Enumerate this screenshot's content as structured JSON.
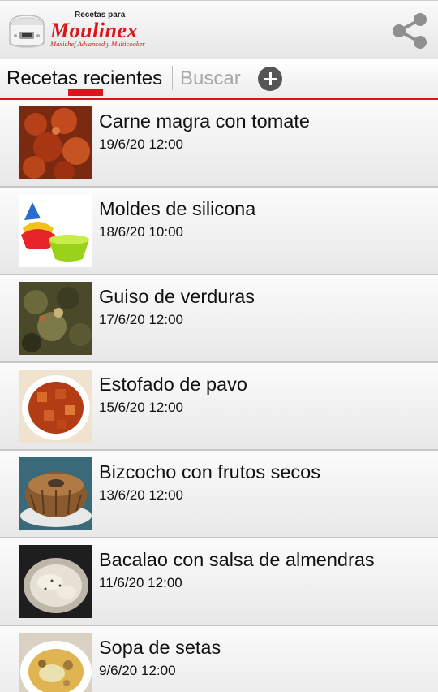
{
  "header": {
    "logo_top": "Recetas para",
    "logo_brand": "Moulinex",
    "logo_sub": "Maxichef Advanced y Multicooker",
    "share_icon": "share-icon",
    "app_icon": "multicooker-icon"
  },
  "tabs": {
    "recent_label": "Recetas recientes",
    "search_label": "Buscar",
    "add_icon": "plus-circle-icon"
  },
  "colors": {
    "accent": "#d9161c",
    "tab_inactive": "#a8a8a8"
  },
  "recipes": [
    {
      "title": "Carne magra con tomate",
      "date": "19/6/20 12:00"
    },
    {
      "title": "Moldes de silicona",
      "date": "18/6/20 10:00"
    },
    {
      "title": "Guiso de verduras",
      "date": "17/6/20 12:00"
    },
    {
      "title": "Estofado de pavo",
      "date": "15/6/20 12:00"
    },
    {
      "title": "Bizcocho con frutos secos",
      "date": "13/6/20 12:00"
    },
    {
      "title": "Bacalao con salsa de almendras",
      "date": "11/6/20 12:00"
    },
    {
      "title": "Sopa de setas",
      "date": "9/6/20 12:00"
    }
  ]
}
